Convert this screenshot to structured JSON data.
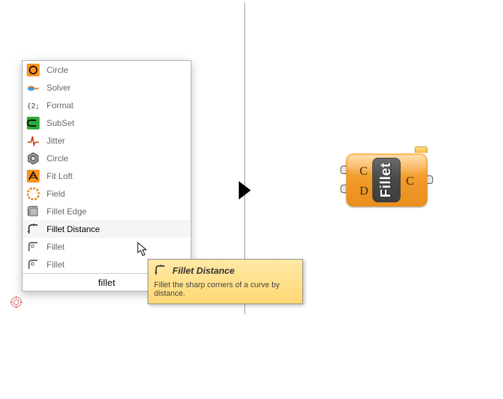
{
  "menu": {
    "items": [
      {
        "label": "Circle"
      },
      {
        "label": "Solver"
      },
      {
        "label": "Format"
      },
      {
        "label": "SubSet"
      },
      {
        "label": "Jitter"
      },
      {
        "label": "Circle"
      },
      {
        "label": "Fit Loft"
      },
      {
        "label": "Field"
      },
      {
        "label": "Fillet Edge"
      },
      {
        "label": "Fillet Distance"
      },
      {
        "label": "Fillet"
      },
      {
        "label": "Fillet"
      }
    ],
    "search_value": "fillet",
    "selected_index": 9
  },
  "tooltip": {
    "title": "Fillet Distance",
    "body": "Fillet the sharp corners of a curve by distance."
  },
  "component": {
    "name": "Fillet",
    "inputs": [
      "C",
      "D"
    ],
    "outputs": [
      "C"
    ]
  }
}
